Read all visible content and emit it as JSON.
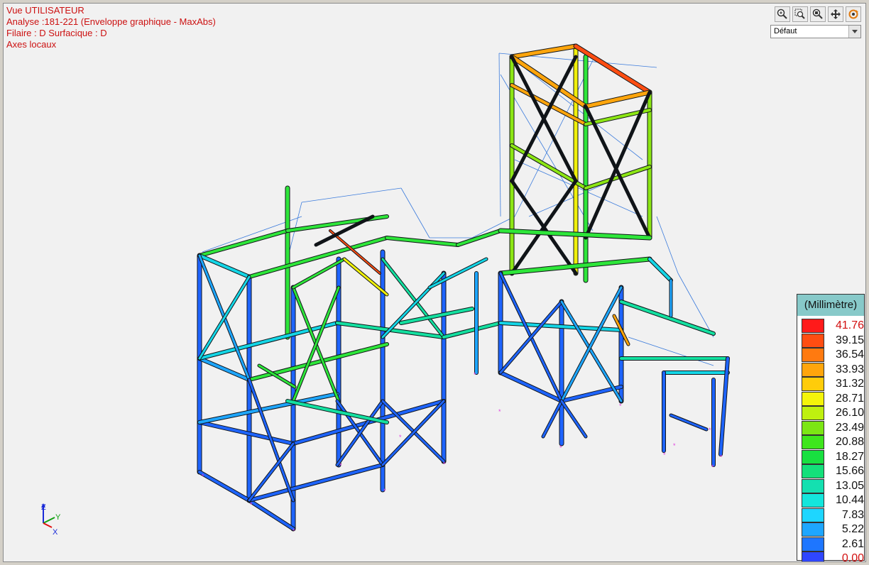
{
  "info": {
    "view": "Vue UTILISATEUR",
    "analysis": "Analyse :181-221 (Enveloppe graphique - MaxAbs)",
    "display": "Filaire : D Surfacique : D",
    "axes": "Axes locaux"
  },
  "toolbar": {
    "buttons": [
      "zoom-in-icon",
      "zoom-window-icon",
      "zoom-fit-icon",
      "pan-icon",
      "rotate-icon"
    ],
    "view_select": "Défaut"
  },
  "legend": {
    "title": "(Millimètre)",
    "entries": [
      {
        "value": "41.76",
        "color": "#ff1a1a",
        "highlight": true
      },
      {
        "value": "39.15",
        "color": "#ff4d12"
      },
      {
        "value": "36.54",
        "color": "#ff7a10"
      },
      {
        "value": "33.93",
        "color": "#ffa50c"
      },
      {
        "value": "31.32",
        "color": "#ffcc0a"
      },
      {
        "value": "28.71",
        "color": "#f4f40a"
      },
      {
        "value": "26.10",
        "color": "#bff00f"
      },
      {
        "value": "23.49",
        "color": "#7ce614"
      },
      {
        "value": "20.88",
        "color": "#3ee61c"
      },
      {
        "value": "18.27",
        "color": "#18e040"
      },
      {
        "value": "15.66",
        "color": "#14e07a"
      },
      {
        "value": "13.05",
        "color": "#14e0b0"
      },
      {
        "value": "10.44",
        "color": "#14e6dc"
      },
      {
        "value": "7.83",
        "color": "#1ed6ff"
      },
      {
        "value": "5.22",
        "color": "#1ea6ff"
      },
      {
        "value": "2.61",
        "color": "#1e76ff"
      },
      {
        "value": "0.00",
        "color": "#2f46ff",
        "highlight": true
      }
    ]
  },
  "triad": {
    "z": "Z",
    "y": "Y",
    "x": "X"
  }
}
